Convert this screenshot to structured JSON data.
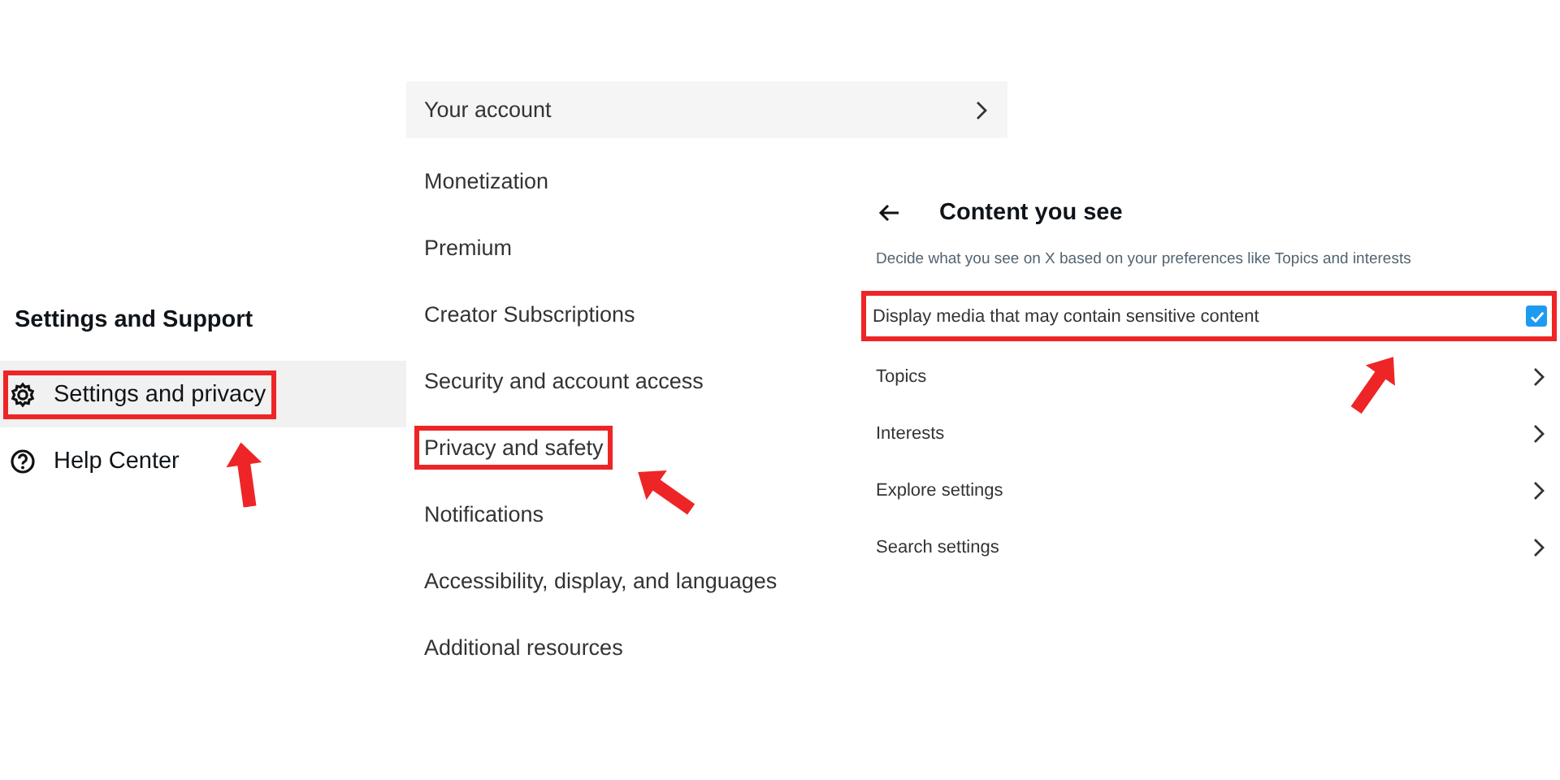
{
  "sidebar": {
    "heading": "Settings and Support",
    "items": [
      {
        "label": "Settings and privacy",
        "selected": true,
        "highlighted": true
      },
      {
        "label": "Help Center",
        "selected": false,
        "highlighted": false
      }
    ]
  },
  "settings_menu": {
    "items": [
      {
        "label": "Your account",
        "selected": true,
        "highlighted": false
      },
      {
        "label": "Monetization",
        "selected": false,
        "highlighted": false
      },
      {
        "label": "Premium",
        "selected": false,
        "highlighted": false
      },
      {
        "label": "Creator Subscriptions",
        "selected": false,
        "highlighted": false
      },
      {
        "label": "Security and account access",
        "selected": false,
        "highlighted": false
      },
      {
        "label": "Privacy and safety",
        "selected": false,
        "highlighted": true
      },
      {
        "label": "Notifications",
        "selected": false,
        "highlighted": false
      },
      {
        "label": "Accessibility, display, and languages",
        "selected": false,
        "highlighted": false
      },
      {
        "label": "Additional resources",
        "selected": false,
        "highlighted": false
      }
    ]
  },
  "content_you_see": {
    "title": "Content you see",
    "description": "Decide what you see on X based on your preferences like Topics and interests",
    "items": [
      {
        "kind": "checkbox",
        "label": "Display media that may contain sensitive content",
        "checked": true,
        "highlighted": true
      },
      {
        "kind": "link",
        "label": "Topics",
        "highlighted": false
      },
      {
        "kind": "link",
        "label": "Interests",
        "highlighted": false
      },
      {
        "kind": "link",
        "label": "Explore settings",
        "highlighted": false
      },
      {
        "kind": "link",
        "label": "Search settings",
        "highlighted": false
      }
    ]
  }
}
